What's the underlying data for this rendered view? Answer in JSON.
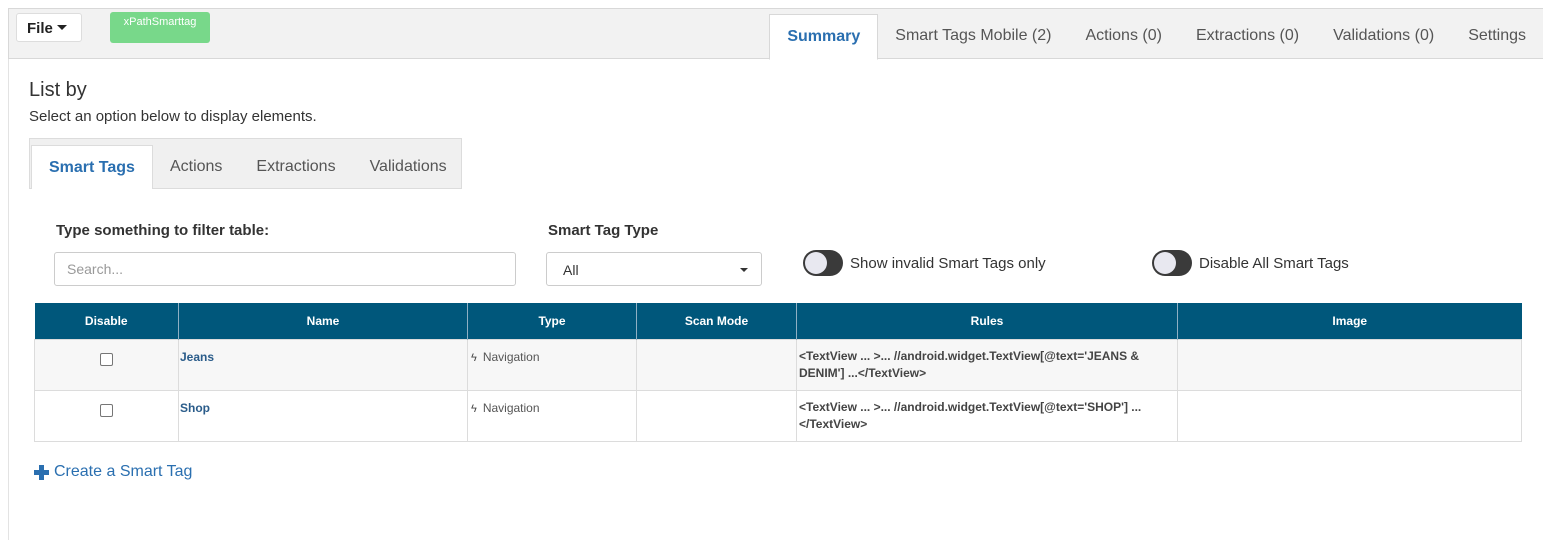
{
  "toolbar": {
    "file_label": "File",
    "badge_label": "xPathSmarttag"
  },
  "top_tabs": [
    {
      "label": "Summary",
      "active": true
    },
    {
      "label": "Smart Tags Mobile (2)",
      "active": false
    },
    {
      "label": "Actions (0)",
      "active": false
    },
    {
      "label": "Extractions (0)",
      "active": false
    },
    {
      "label": "Validations (0)",
      "active": false
    },
    {
      "label": "Settings",
      "active": false
    }
  ],
  "list_by": {
    "title": "List by",
    "subtitle": "Select an option below to display elements."
  },
  "sub_tabs": [
    {
      "label": "Smart Tags",
      "active": true
    },
    {
      "label": "Actions",
      "active": false
    },
    {
      "label": "Extractions",
      "active": false
    },
    {
      "label": "Validations",
      "active": false
    }
  ],
  "filter": {
    "label": "Type something to filter table:",
    "value": "",
    "placeholder": "Search..."
  },
  "type_filter": {
    "label": "Smart Tag Type",
    "selected": "All"
  },
  "toggles": {
    "invalid_only": {
      "label": "Show invalid Smart Tags only",
      "on": false
    },
    "disable_all": {
      "label": "Disable All Smart Tags",
      "on": false
    }
  },
  "table": {
    "headers": [
      "Disable",
      "Name",
      "Type",
      "Scan Mode",
      "Rules",
      "Image"
    ],
    "rows": [
      {
        "disabled": false,
        "name": "Jeans",
        "type": "Navigation",
        "scan_mode": "",
        "rules": "<TextView ... >... //android.widget.TextView[@text='JEANS & DENIM'] ...</TextView>",
        "image": ""
      },
      {
        "disabled": false,
        "name": "Shop",
        "type": "Navigation",
        "scan_mode": "",
        "rules": "<TextView ... >... //android.widget.TextView[@text='SHOP'] ... </TextView>",
        "image": ""
      }
    ]
  },
  "create_link": "Create a Smart Tag",
  "colors": {
    "header_bg": "#00577b",
    "accent": "#2a6fb0",
    "badge": "#78d88a"
  }
}
